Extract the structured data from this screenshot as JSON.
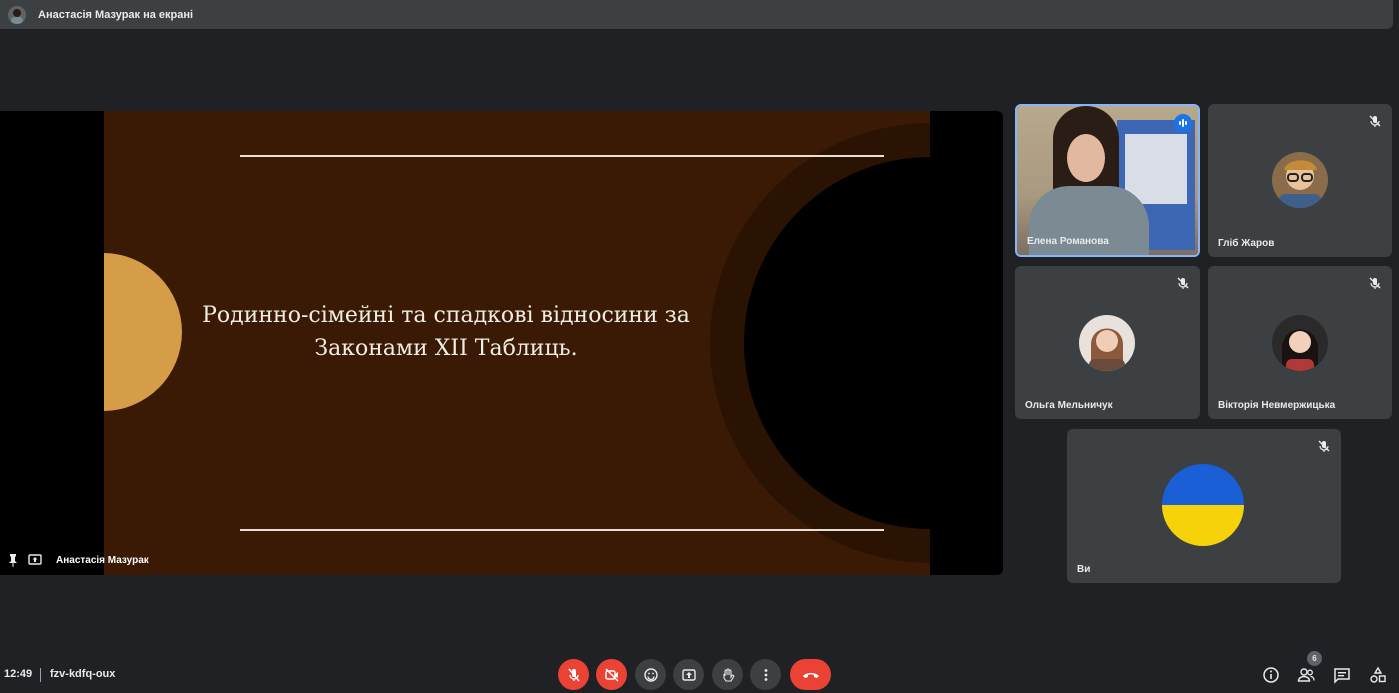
{
  "topbar": {
    "presenting_label": "Анастасія Мазурак на екрані"
  },
  "slide": {
    "title": "Родинно-сімейні та спадкові відносини за Законами XII Таблиць."
  },
  "stage": {
    "presenter_name": "Анастасія Мазурак"
  },
  "participants": [
    {
      "name": "Елена Романова",
      "muted": false,
      "speaking": true
    },
    {
      "name": "Гліб Жаров",
      "muted": true
    },
    {
      "name": "Ольга Мельничук",
      "muted": true
    },
    {
      "name": "Вікторія Невмержицька",
      "muted": true
    },
    {
      "name": "Ви",
      "muted": true
    }
  ],
  "bottombar": {
    "time": "12:49",
    "meeting_code": "fzv-kdfq-oux",
    "people_count": "6"
  },
  "colors": {
    "accent": "#8ab4f8",
    "danger": "#ea4335",
    "slide_bg": "#3a1a04",
    "slide_accent": "#d59d48"
  },
  "icons": {
    "mic_off": "mic-off-icon",
    "cam_off": "camera-off-icon",
    "emoji": "emoji-icon",
    "present": "present-screen-icon",
    "hand": "raise-hand-icon",
    "more": "more-vert-icon",
    "hangup": "call-end-icon",
    "info": "info-icon",
    "people": "people-icon",
    "chat": "chat-icon",
    "activities": "activities-icon"
  }
}
